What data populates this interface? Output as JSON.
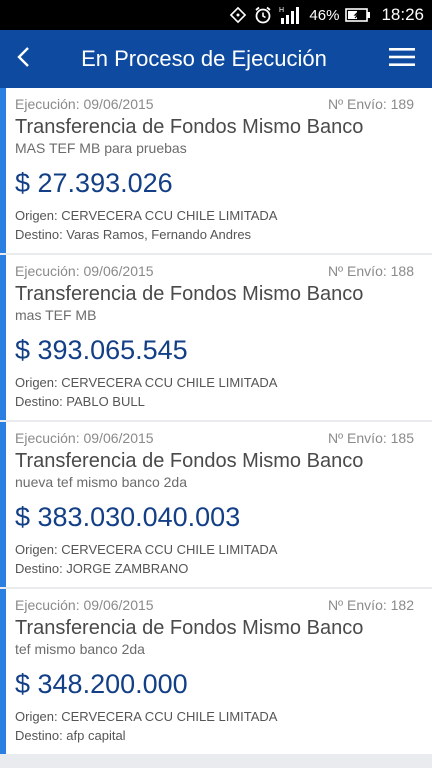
{
  "status_bar": {
    "battery": "46%",
    "time": "18:26",
    "icons": [
      "rotate-icon",
      "alarm-icon",
      "signal-icon",
      "battery-icon"
    ]
  },
  "header": {
    "title": "En Proceso de Ejecución",
    "back_icon": "chevron-left-icon",
    "menu_icon": "hamburger-menu-icon"
  },
  "colors": {
    "appbar": "#0d4aa0",
    "accent": "#2b7fe0",
    "amount": "#133f86"
  },
  "transfers": [
    {
      "execution": "Ejecución: 09/06/2015",
      "send_no": "Nº Envío: 189",
      "type": "Transferencia de Fondos Mismo Banco",
      "description": "MAS TEF MB para pruebas",
      "amount": "$ 27.393.026",
      "origin": "Origen: CERVECERA CCU CHILE LIMITADA",
      "destination": "Destino: Varas Ramos, Fernando Andres"
    },
    {
      "execution": "Ejecución: 09/06/2015",
      "send_no": "Nº Envío: 188",
      "type": "Transferencia de Fondos Mismo Banco",
      "description": "mas TEF MB",
      "amount": "$ 393.065.545",
      "origin": "Origen: CERVECERA CCU CHILE LIMITADA",
      "destination": "Destino: PABLO BULL"
    },
    {
      "execution": "Ejecución: 09/06/2015",
      "send_no": "Nº Envío: 185",
      "type": "Transferencia de Fondos Mismo Banco",
      "description": "nueva tef mismo banco 2da",
      "amount": "$ 383.030.040.003",
      "origin": "Origen: CERVECERA CCU CHILE LIMITADA",
      "destination": "Destino: JORGE ZAMBRANO"
    },
    {
      "execution": "Ejecución: 09/06/2015",
      "send_no": "Nº Envío: 182",
      "type": "Transferencia de Fondos Mismo Banco",
      "description": "tef mismo banco 2da",
      "amount": "$ 348.200.000",
      "origin": "Origen: CERVECERA CCU CHILE LIMITADA",
      "destination": "Destino: afp capital"
    }
  ]
}
